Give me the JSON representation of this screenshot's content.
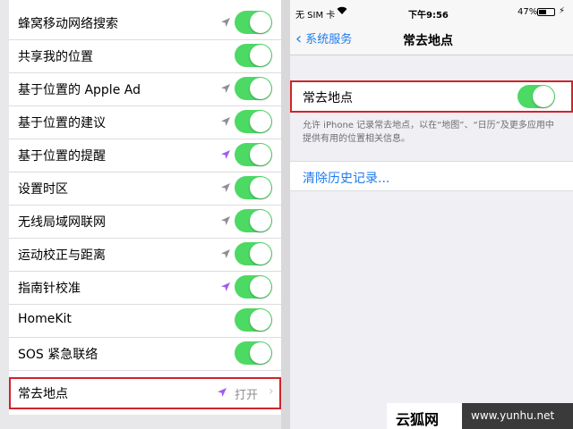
{
  "left_list": {
    "rows": [
      {
        "label": "蜂窝移动网络搜索",
        "arrow": "gray",
        "toggle": true
      },
      {
        "label": "共享我的位置",
        "arrow": "none",
        "toggle": true
      },
      {
        "label": "基于位置的 Apple Ad",
        "arrow": "gray",
        "toggle": true
      },
      {
        "label": "基于位置的建议",
        "arrow": "gray",
        "toggle": true
      },
      {
        "label": "基于位置的提醒",
        "arrow": "purple",
        "toggle": true
      },
      {
        "label": "设置时区",
        "arrow": "gray",
        "toggle": true
      },
      {
        "label": "无线局域网联网",
        "arrow": "gray",
        "toggle": true
      },
      {
        "label": "运动校正与距离",
        "arrow": "gray",
        "toggle": true
      },
      {
        "label": "指南针校准",
        "arrow": "purple",
        "toggle": true
      },
      {
        "label": "HomeKit",
        "arrow": "none",
        "toggle": true
      },
      {
        "label": "SOS 紧急联络",
        "arrow": "none",
        "toggle": true
      },
      {
        "label": "常去地点",
        "arrow": "purple",
        "toggle": false,
        "value": "打开",
        "highlighted": true
      }
    ]
  },
  "colors": {
    "toggle_on": "#4cd964",
    "arrow_gray": "#8e8e93",
    "arrow_purple": "#a05df0",
    "highlight_border": "#d0242b",
    "ios_blue": "#1f7bf0"
  },
  "status_bar": {
    "carrier": "无 SIM 卡",
    "wifi_icon": "wifi-icon",
    "time": "下午9:56",
    "battery_percent": "47%",
    "battery_level": 0.47
  },
  "nav": {
    "back_label": "系统服务",
    "title": "常去地点"
  },
  "settings": {
    "toggle_label": "常去地点",
    "toggle_on": true,
    "description": "允许 iPhone 记录常去地点，以在“地图”、“日历”及更多应用中提供有用的位置相关信息。",
    "clear_history": "清除历史记录..."
  },
  "watermark": {
    "left_text": "云狐网",
    "right_text": "www.yunhu.net"
  }
}
